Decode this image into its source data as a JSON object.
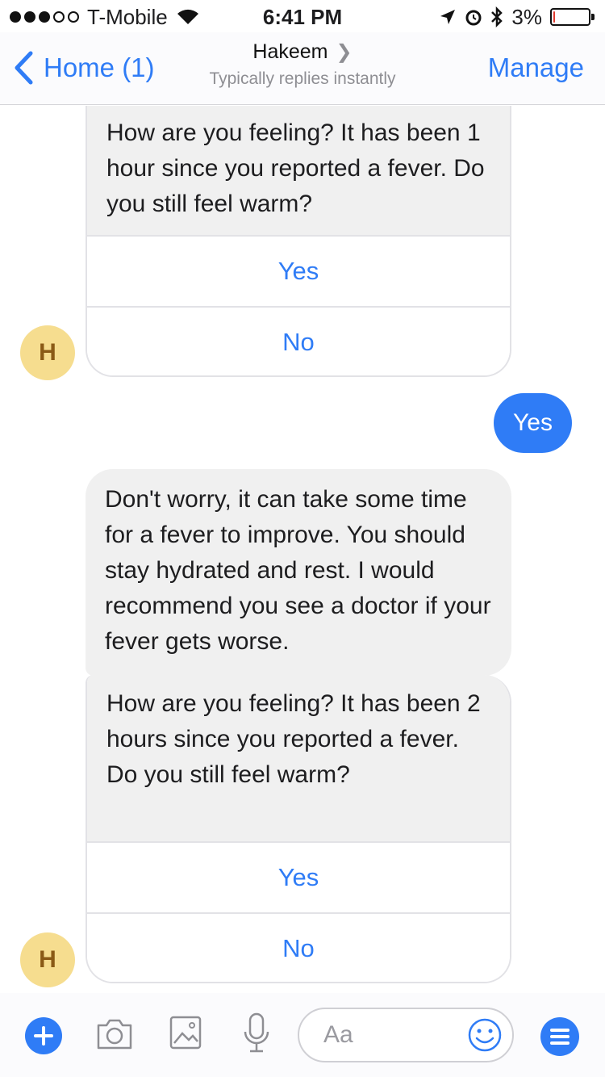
{
  "status_bar": {
    "carrier": "T-Mobile",
    "time": "6:41 PM",
    "battery_percent": "3%",
    "battery_level": 0.03
  },
  "nav": {
    "back_label": "Home (1)",
    "contact_name": "Hakeem",
    "subtitle": "Typically replies instantly",
    "manage_label": "Manage"
  },
  "messages": {
    "q1": {
      "text": "How are you feeling? It has been 1 hour since you reported a fever. Do you still feel warm?",
      "yes": "Yes",
      "no": "No"
    },
    "user_reply": "Yes",
    "bot_reply": "Don't worry, it can take some time for a fever to improve. You should stay hydrated and rest. I would recommend you see a doctor if your fever gets worse.",
    "q2": {
      "text": "How are you feeling? It has been 2 hours since you reported a fever. Do you still feel warm?",
      "yes": "Yes",
      "no": "No"
    },
    "avatar_letter": "H"
  },
  "composer": {
    "placeholder": "Aa"
  },
  "colors": {
    "accent": "#2f7cf6",
    "bubble_gray": "#f0f0f0",
    "avatar_bg": "#f6dd8f"
  }
}
